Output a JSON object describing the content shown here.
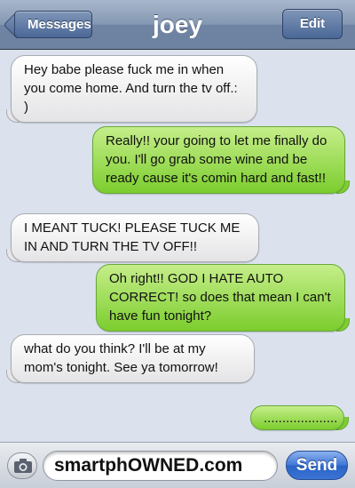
{
  "navbar": {
    "back_label": "Messages",
    "title": "joey",
    "edit_label": "Edit"
  },
  "messages": [
    {
      "direction": "incoming",
      "text": "Hey babe please fuck me in when you come home. And turn the tv off.: )"
    },
    {
      "direction": "outgoing",
      "text": "Really!! your going to let me finally do you. I'll go grab some wine and be ready cause it's comin hard and fast!!"
    },
    {
      "direction": "incoming",
      "text": "I MEANT TUCK! PLEASE TUCK ME IN AND TURN THE TV OFF!!"
    },
    {
      "direction": "outgoing",
      "text": "Oh right!! GOD I HATE AUTO CORRECT! so does that mean I can't have fun tonight?"
    },
    {
      "direction": "incoming",
      "text": "what do you think? I'll be at my mom's tonight. See ya tomorrow!"
    },
    {
      "direction": "outgoing",
      "text": "...................."
    }
  ],
  "input_bar": {
    "camera_icon": "camera-icon",
    "text_value": "smartphOWNED.com",
    "send_label": "Send"
  },
  "colors": {
    "navbar": "#7b8fab",
    "incoming_bubble": "#e6e6e8",
    "outgoing_bubble": "#8ad43c",
    "send_button": "#3b74d4",
    "background": "#dbe2ed"
  }
}
